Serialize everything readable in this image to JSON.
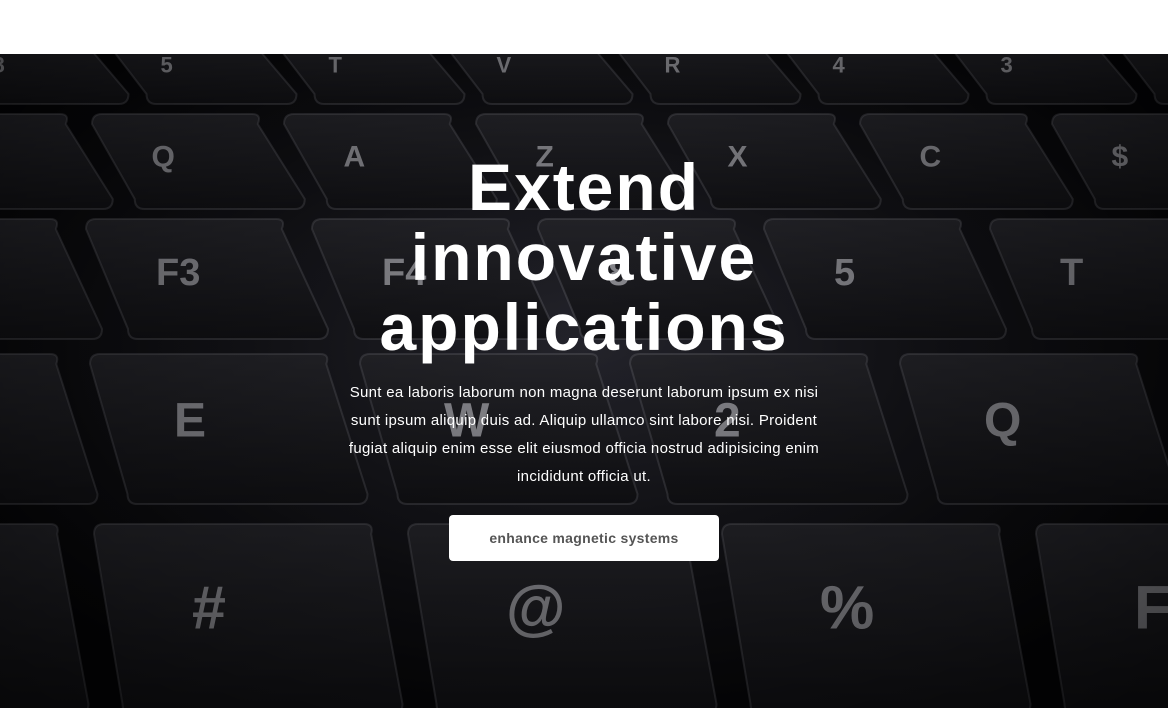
{
  "hero": {
    "title": "Extend innovative applications",
    "text": "Sunt ea laboris laborum non magna deserunt laborum ipsum ex nisi sunt ipsum aliquip duis ad. Aliquip ullamco sint labore nisi. Proident fugiat aliquip enim esse elit eiusmod officia nostrud adipisicing enim incididunt officia ut.",
    "button_label": "enhance magnetic systems",
    "background_description_icon": "keyboard-photo",
    "keycaps": [
      "8",
      "5",
      "T",
      "V",
      "R",
      "4",
      "3",
      "E",
      "W",
      "2",
      "Q",
      "A",
      "Z",
      "X",
      "C",
      "$",
      "#",
      "@",
      "%",
      "F3",
      "F4"
    ]
  },
  "colors": {
    "page_background": "#ffffff",
    "hero_background": "#08080b",
    "key_color": "#1b1b20",
    "hero_text": "#ffffff",
    "button_background": "#ffffff",
    "button_text": "#555555"
  }
}
